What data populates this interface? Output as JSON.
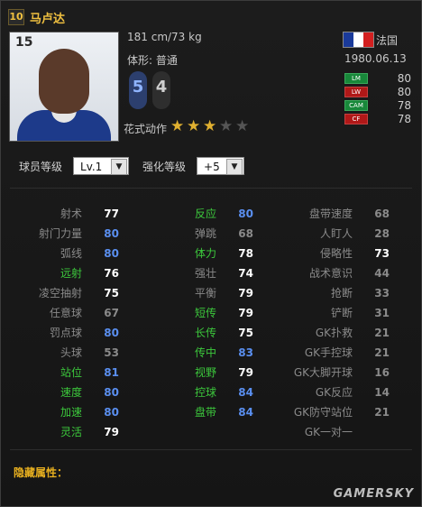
{
  "player": {
    "season_number": "10",
    "name": "马卢达",
    "overall": "15",
    "height_weight": "181 cm/73 kg",
    "body_type": "体形: 普通",
    "left_foot": "5",
    "right_foot": "4",
    "skill_moves_label": "花式动作",
    "skill_moves_stars": 3,
    "skill_moves_max": 5,
    "nation": "法国",
    "dob": "1980.06.13",
    "flag_colors": [
      "#1a3a9a",
      "#ffffff",
      "#d32020"
    ]
  },
  "positions": [
    {
      "code": "LM",
      "value": "80",
      "color": "green"
    },
    {
      "code": "LW",
      "value": "80",
      "color": "red"
    },
    {
      "code": "CAM",
      "value": "78",
      "color": "green"
    },
    {
      "code": "CF",
      "value": "78",
      "color": "red"
    }
  ],
  "controls": {
    "level_label": "球员等级",
    "level_value": "Lv.1",
    "enhance_label": "强化等级",
    "enhance_value": "+5"
  },
  "colors": {
    "white": "#ffffff",
    "blue": "#5a8ff0",
    "green": "#3cc83c",
    "grey": "#8a8a8a",
    "accent": "#e8b020"
  },
  "stats": {
    "col1": [
      {
        "name": "射术",
        "value": "77",
        "name_color": "grey",
        "value_color": "white"
      },
      {
        "name": "射门力量",
        "value": "80",
        "name_color": "grey",
        "value_color": "blue"
      },
      {
        "name": "弧线",
        "value": "80",
        "name_color": "grey",
        "value_color": "blue"
      },
      {
        "name": "远射",
        "value": "76",
        "name_color": "green",
        "value_color": "white"
      },
      {
        "name": "凌空抽射",
        "value": "75",
        "name_color": "grey",
        "value_color": "white"
      },
      {
        "name": "任意球",
        "value": "67",
        "name_color": "grey",
        "value_color": "grey"
      },
      {
        "name": "罚点球",
        "value": "80",
        "name_color": "grey",
        "value_color": "blue"
      },
      {
        "name": "头球",
        "value": "53",
        "name_color": "grey",
        "value_color": "grey"
      },
      {
        "name": "站位",
        "value": "81",
        "name_color": "green",
        "value_color": "blue"
      },
      {
        "name": "速度",
        "value": "80",
        "name_color": "green",
        "value_color": "blue"
      },
      {
        "name": "加速",
        "value": "80",
        "name_color": "green",
        "value_color": "blue"
      },
      {
        "name": "灵活",
        "value": "79",
        "name_color": "green",
        "value_color": "white"
      }
    ],
    "col2": [
      {
        "name": "反应",
        "value": "80",
        "name_color": "green",
        "value_color": "blue"
      },
      {
        "name": "弹跳",
        "value": "68",
        "name_color": "grey",
        "value_color": "grey"
      },
      {
        "name": "体力",
        "value": "78",
        "name_color": "green",
        "value_color": "white"
      },
      {
        "name": "强壮",
        "value": "74",
        "name_color": "grey",
        "value_color": "white"
      },
      {
        "name": "平衡",
        "value": "79",
        "name_color": "grey",
        "value_color": "white"
      },
      {
        "name": "短传",
        "value": "79",
        "name_color": "green",
        "value_color": "white"
      },
      {
        "name": "长传",
        "value": "75",
        "name_color": "green",
        "value_color": "white"
      },
      {
        "name": "传中",
        "value": "83",
        "name_color": "green",
        "value_color": "blue"
      },
      {
        "name": "视野",
        "value": "79",
        "name_color": "green",
        "value_color": "white"
      },
      {
        "name": "控球",
        "value": "84",
        "name_color": "green",
        "value_color": "blue"
      },
      {
        "name": "盘带",
        "value": "84",
        "name_color": "green",
        "value_color": "blue"
      }
    ],
    "col3": [
      {
        "name": "盘带速度",
        "value": "68",
        "name_color": "grey",
        "value_color": "grey"
      },
      {
        "name": "人盯人",
        "value": "28",
        "name_color": "grey",
        "value_color": "grey"
      },
      {
        "name": "侵略性",
        "value": "73",
        "name_color": "grey",
        "value_color": "white"
      },
      {
        "name": "战术意识",
        "value": "44",
        "name_color": "grey",
        "value_color": "grey"
      },
      {
        "name": "抢断",
        "value": "33",
        "name_color": "grey",
        "value_color": "grey"
      },
      {
        "name": "铲断",
        "value": "31",
        "name_color": "grey",
        "value_color": "grey"
      },
      {
        "name": "GK扑救",
        "value": "21",
        "name_color": "grey",
        "value_color": "grey"
      },
      {
        "name": "GK手控球",
        "value": "21",
        "name_color": "grey",
        "value_color": "grey"
      },
      {
        "name": "GK大脚开球",
        "value": "16",
        "name_color": "grey",
        "value_color": "grey"
      },
      {
        "name": "GK反应",
        "value": "14",
        "name_color": "grey",
        "value_color": "grey"
      },
      {
        "name": "GK防守站位",
        "value": "21",
        "name_color": "grey",
        "value_color": "grey"
      },
      {
        "name": "GK一对一",
        "value": "",
        "name_color": "grey",
        "value_color": "grey"
      }
    ]
  },
  "hidden_attributes_label": "隐藏属性：",
  "watermark": "GAMERSKY"
}
